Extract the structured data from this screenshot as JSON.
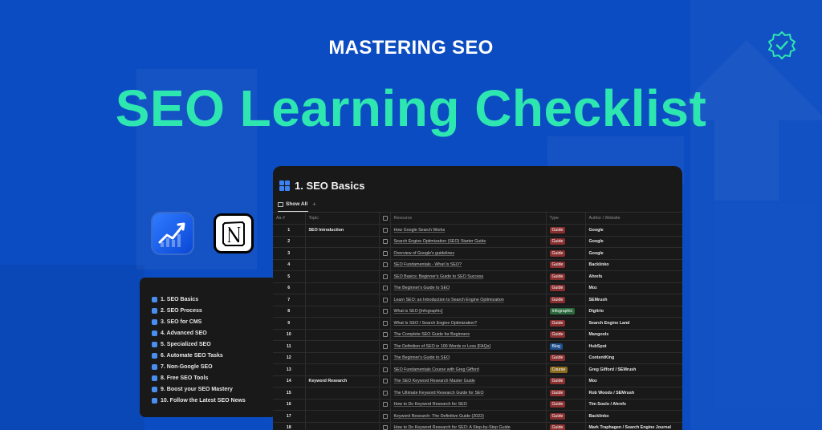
{
  "header": {
    "subtitle": "MASTERING SEO",
    "title": "SEO Learning Checklist"
  },
  "icons": {
    "verified": "verified-badge-icon",
    "chart_app": "trending-chart-icon",
    "notion_app": "notion-logo-icon"
  },
  "colors": {
    "background": "#0b4cc2",
    "title": "#2ee6b0",
    "panel": "#191919",
    "tag_guide": "#8a2f2f",
    "tag_infographic": "#2b6a3e",
    "tag_blog": "#1f4e8c",
    "tag_course": "#8a6a1f"
  },
  "toc": {
    "items": [
      "1. SEO Basics",
      "2. SEO Process",
      "3. SEO for CMS",
      "4. Advanced SEO",
      "5. Specialized SEO",
      "6. Automate SEO Tasks",
      "7. Non-Google SEO",
      "8. Free SEO Tools",
      "9. Boost your SEO Mastery",
      "10. Follow the Latest SEO News"
    ]
  },
  "panel": {
    "title": "1. SEO Basics",
    "view_tab": "Show All",
    "add_view": "+",
    "columns": [
      "Aa #",
      "Topic",
      "",
      "Resource",
      "Type",
      "Author / Website"
    ],
    "rows": [
      {
        "num": "1",
        "topic": "SEO Introduction",
        "resource": "How Google Search Works",
        "type": "Guide",
        "author": "Google"
      },
      {
        "num": "2",
        "topic": "",
        "resource": "Search Engine Optimization (SEO) Starter Guide",
        "type": "Guide",
        "author": "Google"
      },
      {
        "num": "3",
        "topic": "",
        "resource": "Overview of Google's guidelines",
        "type": "Guide",
        "author": "Google"
      },
      {
        "num": "4",
        "topic": "",
        "resource": "SEO Fundamentals - What Is SEO?",
        "type": "Guide",
        "author": "Backlinko"
      },
      {
        "num": "5",
        "topic": "",
        "resource": "SEO Basics: Beginner's Guide to SEO Success",
        "type": "Guide",
        "author": "Ahrefs"
      },
      {
        "num": "6",
        "topic": "",
        "resource": "The Beginner's Guide to SEO",
        "type": "Guide",
        "author": "Moz"
      },
      {
        "num": "7",
        "topic": "",
        "resource": "Learn SEO: an Introduction to Search Engine Optimization",
        "type": "Guide",
        "author": "SEMrush"
      },
      {
        "num": "8",
        "topic": "",
        "resource": "What is SEO [Infographic]",
        "type": "Infographic",
        "author": "Digitrio"
      },
      {
        "num": "9",
        "topic": "",
        "resource": "What Is SEO / Search Engine Optimization?",
        "type": "Guide",
        "author": "Search Engine Land"
      },
      {
        "num": "10",
        "topic": "",
        "resource": "The Complete SEO Guide for Beginners",
        "type": "Guide",
        "author": "Mangools"
      },
      {
        "num": "11",
        "topic": "",
        "resource": "The Definition of SEO in 100 Words or Less [FAQs]",
        "type": "Blog",
        "author": "HubSpot"
      },
      {
        "num": "12",
        "topic": "",
        "resource": "The Beginner's Guide to SEO",
        "type": "Guide",
        "author": "ContentKing"
      },
      {
        "num": "13",
        "topic": "",
        "resource": "SEO Fundamentals Course with Greg Gifford",
        "type": "Course",
        "author": "Greg Gifford / SEMrush"
      },
      {
        "num": "14",
        "topic": "Keyword Research",
        "resource": "The SEO Keyword Research Master Guide",
        "type": "Guide",
        "author": "Moz"
      },
      {
        "num": "15",
        "topic": "",
        "resource": "The Ultimate Keyword Research Guide for SEO",
        "type": "Guide",
        "author": "Rob Woods / SEMrush"
      },
      {
        "num": "16",
        "topic": "",
        "resource": "How to Do Keyword Research for SEO",
        "type": "Guide",
        "author": "Tim Soulo / Ahrefs"
      },
      {
        "num": "17",
        "topic": "",
        "resource": "Keyword Research: The Definitive Guide (2022)",
        "type": "Guide",
        "author": "Backlinko"
      },
      {
        "num": "18",
        "topic": "",
        "resource": "How to Do Keyword Research for SEO: A Step-by-Step Guide",
        "type": "Guide",
        "author": "Mark Traphagen / Search Engine Journal"
      }
    ]
  }
}
